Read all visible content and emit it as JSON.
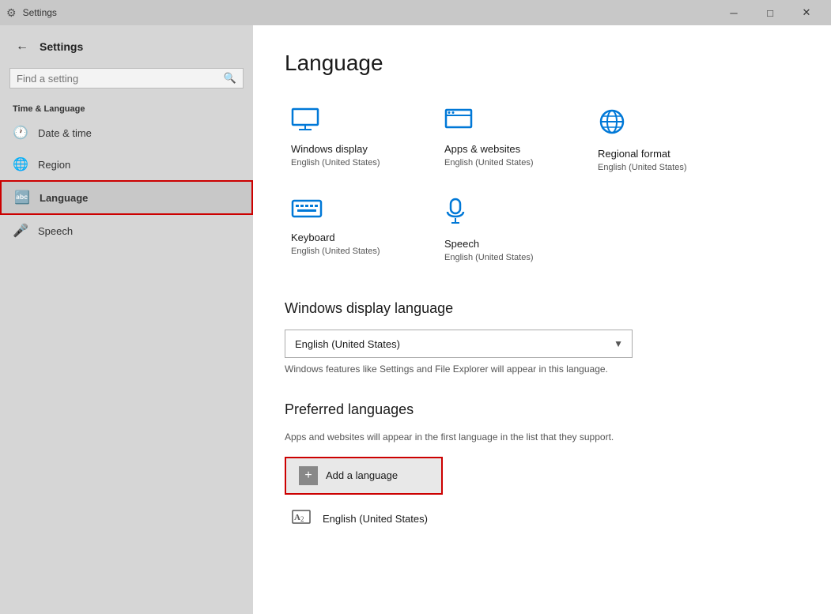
{
  "titleBar": {
    "title": "Settings",
    "minBtn": "─",
    "maxBtn": "□",
    "closeBtn": "✕"
  },
  "sidebar": {
    "backBtnLabel": "←",
    "appTitle": "Settings",
    "search": {
      "placeholder": "Find a setting",
      "searchIconLabel": "🔍"
    },
    "sectionTitle": "Time & Language",
    "navItems": [
      {
        "id": "date-time",
        "label": "Date & time",
        "icon": "🕐"
      },
      {
        "id": "region",
        "label": "Region",
        "icon": "🌐"
      },
      {
        "id": "language",
        "label": "Language",
        "icon": "🔤",
        "active": true
      },
      {
        "id": "speech",
        "label": "Speech",
        "icon": "🎤"
      }
    ]
  },
  "main": {
    "pageTitle": "Language",
    "categories": [
      {
        "id": "windows-display",
        "icon": "🖥",
        "name": "Windows display",
        "sub": "English (United States)"
      },
      {
        "id": "apps-websites",
        "icon": "🪟",
        "name": "Apps & websites",
        "sub": "English (United States)"
      },
      {
        "id": "regional-format",
        "icon": "🌐",
        "name": "Regional format",
        "sub": "English (United States)"
      },
      {
        "id": "keyboard",
        "icon": "⌨",
        "name": "Keyboard",
        "sub": "English (United States)"
      },
      {
        "id": "speech",
        "icon": "🎤",
        "name": "Speech",
        "sub": "English (United States)"
      }
    ],
    "windowsDisplayLang": {
      "sectionTitle": "Windows display language",
      "selectedOption": "English (United States)",
      "options": [
        "English (United States)"
      ],
      "description": "Windows features like Settings and File Explorer will appear in this language."
    },
    "preferredLanguages": {
      "sectionTitle": "Preferred languages",
      "description": "Apps and websites will appear in the first language in the list that they support.",
      "addBtn": "Add a language",
      "langList": [
        {
          "id": "en-us",
          "icon": "🔤",
          "name": "English (United States)"
        }
      ]
    }
  }
}
